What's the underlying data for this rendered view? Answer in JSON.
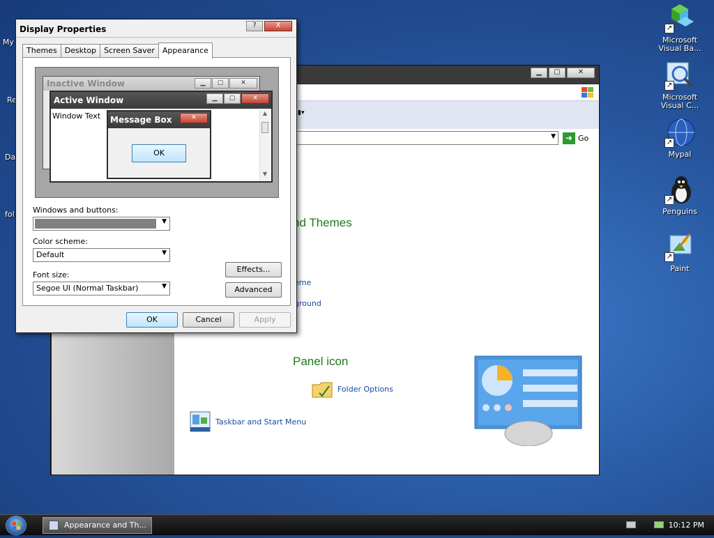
{
  "desktop": {
    "left_edge_labels": [
      "My",
      "Re",
      "Da",
      "fol"
    ],
    "icons": [
      {
        "name": "microsoft-visual-basic",
        "label": "Microsoft Visual Ba...",
        "icon": "cubes-icon"
      },
      {
        "name": "microsoft-visual-c",
        "label": "Microsoft Visual C...",
        "icon": "magnifier-icon"
      },
      {
        "name": "mypal",
        "label": "Mypal",
        "icon": "globe-icon"
      },
      {
        "name": "penguins",
        "label": "Penguins",
        "icon": "penguin-icon"
      },
      {
        "name": "paint",
        "label": "Paint",
        "icon": "paint-icon"
      }
    ]
  },
  "control_panel": {
    "go_label": "Go",
    "heading_1": "nd Themes",
    "link_1": "eme",
    "link_2": "ground",
    "heading_2": "Panel icon",
    "items": [
      {
        "label": "Folder Options",
        "icon": "folder-options-icon"
      },
      {
        "label": "Taskbar and Start Menu",
        "icon": "taskbar-icon"
      }
    ]
  },
  "dialog": {
    "title": "Display Properties",
    "help_btn": "?",
    "close_btn": "X",
    "tabs": [
      "Themes",
      "Desktop",
      "Screen Saver",
      "Appearance"
    ],
    "active_tab": "Appearance",
    "preview": {
      "inactive_title": "Inactive Window",
      "active_title": "Active Window",
      "window_text": "Window Text",
      "msgbox_title": "Message Box",
      "msgbox_ok": "OK"
    },
    "windows_and_buttons_label": "Windows and buttons:",
    "windows_and_buttons_value": "",
    "color_scheme_label": "Color scheme:",
    "color_scheme_value": "Default",
    "font_size_label": "Font size:",
    "font_size_value": "Segoe UI (Normal Taskbar)",
    "effects_btn": "Effects...",
    "advanced_btn": "Advanced",
    "ok_btn": "OK",
    "cancel_btn": "Cancel",
    "apply_btn": "Apply"
  },
  "taskbar": {
    "task_label": "Appearance and Th...",
    "clock": "10:12 PM"
  }
}
